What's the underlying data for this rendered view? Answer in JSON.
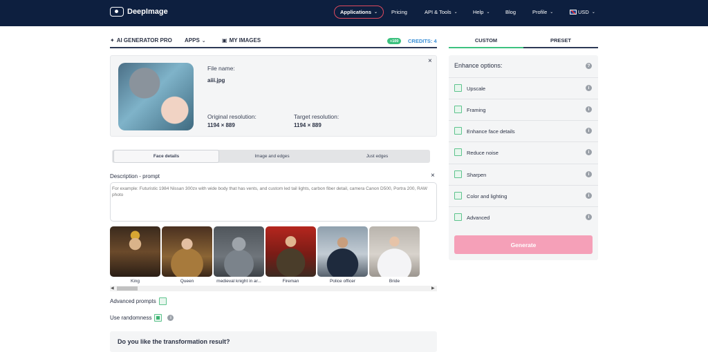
{
  "header": {
    "brand": "DeepImage",
    "nav": {
      "applications": "Applications",
      "pricing": "Pricing",
      "api_tools": "API & Tools",
      "help": "Help",
      "blog": "Blog",
      "profile": "Profile",
      "currency": "USD"
    }
  },
  "subnav": {
    "ai_generator": "AI GENERATOR PRO",
    "apps": "APPS",
    "my_images": "MY IMAGES",
    "credits_badge": "+100",
    "credits": "CREDITS: 4"
  },
  "file": {
    "name_label": "File name:",
    "name": "aiii.jpg",
    "original_label": "Original resolution:",
    "original": "1194 × 889",
    "target_label": "Target resolution:",
    "target": "1194 × 889"
  },
  "modes": [
    "Face details",
    "Image and edges",
    "Just edges"
  ],
  "prompt": {
    "label": "Description - prompt",
    "placeholder": "For example: Futuristic 1984 Nissan 300zx with wide body that has vents, and custom led tail lights, carbon fiber detail, camera Canon D500, Portra 200, RAW photo"
  },
  "presets": [
    {
      "label": "King"
    },
    {
      "label": "Queen"
    },
    {
      "label": "medieval knight in ar..."
    },
    {
      "label": "Fireman"
    },
    {
      "label": "Police officer"
    },
    {
      "label": "Bride"
    }
  ],
  "options_left": {
    "advanced_prompts": "Advanced prompts",
    "use_randomness": "Use randomness"
  },
  "feedback": "Do you like the transformation result?",
  "right": {
    "tab_custom": "CUSTOM",
    "tab_preset": "PRESET",
    "enhance_title": "Enhance options:",
    "options": [
      "Upscale",
      "Framing",
      "Enhance face details",
      "Reduce noise",
      "Sharpen",
      "Color and lighting",
      "Advanced"
    ],
    "generate": "Generate"
  },
  "colors": {
    "header_bg": "#0d1f3f",
    "accent_green": "#3cc17f",
    "credits_blue": "#3a8fd6",
    "generate_pink": "#f5a0b8",
    "applications_ring": "#e04a5f"
  }
}
